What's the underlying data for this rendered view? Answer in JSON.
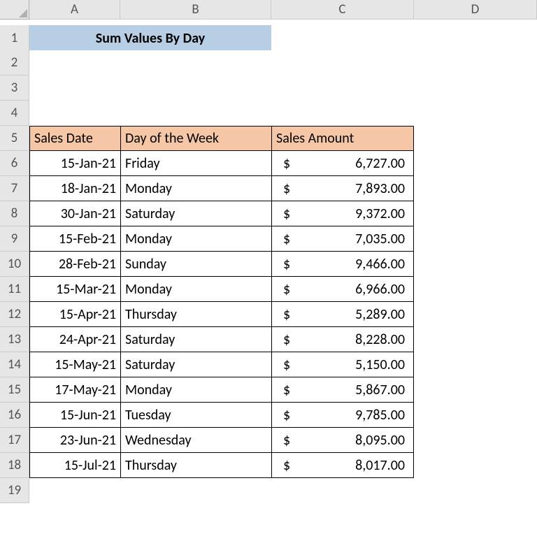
{
  "columns": [
    "A",
    "B",
    "C",
    "D"
  ],
  "row_labels": [
    "1",
    "2",
    "3",
    "4",
    "5",
    "6",
    "7",
    "8",
    "9",
    "10",
    "11",
    "12",
    "13",
    "14",
    "15",
    "16",
    "17",
    "18",
    "19"
  ],
  "title": "Sum Values By Day",
  "headers": {
    "a": "Sales Date",
    "b": "Day of the Week",
    "c": "Sales Amount"
  },
  "currency_symbol": "$",
  "rows": [
    {
      "date": "15-Jan-21",
      "dow": "Friday",
      "amount": "6,727.00"
    },
    {
      "date": "18-Jan-21",
      "dow": "Monday",
      "amount": "7,893.00"
    },
    {
      "date": "30-Jan-21",
      "dow": "Saturday",
      "amount": "9,372.00"
    },
    {
      "date": "15-Feb-21",
      "dow": "Monday",
      "amount": "7,035.00"
    },
    {
      "date": "28-Feb-21",
      "dow": "Sunday",
      "amount": "9,466.00"
    },
    {
      "date": "15-Mar-21",
      "dow": "Monday",
      "amount": "6,966.00"
    },
    {
      "date": "15-Apr-21",
      "dow": "Thursday",
      "amount": "5,289.00"
    },
    {
      "date": "24-Apr-21",
      "dow": "Saturday",
      "amount": "8,228.00"
    },
    {
      "date": "15-May-21",
      "dow": "Saturday",
      "amount": "5,150.00"
    },
    {
      "date": "17-May-21",
      "dow": "Monday",
      "amount": "5,867.00"
    },
    {
      "date": "15-Jun-21",
      "dow": "Tuesday",
      "amount": "9,785.00"
    },
    {
      "date": "23-Jun-21",
      "dow": "Wednesday",
      "amount": "8,095.00"
    },
    {
      "date": "15-Jul-21",
      "dow": "Thursday",
      "amount": "8,017.00"
    }
  ],
  "chart_data": {
    "type": "table",
    "title": "Sum Values By Day",
    "columns": [
      "Sales Date",
      "Day of the Week",
      "Sales Amount ($)"
    ],
    "rows": [
      [
        "15-Jan-21",
        "Friday",
        6727.0
      ],
      [
        "18-Jan-21",
        "Monday",
        7893.0
      ],
      [
        "30-Jan-21",
        "Saturday",
        9372.0
      ],
      [
        "15-Feb-21",
        "Monday",
        7035.0
      ],
      [
        "28-Feb-21",
        "Sunday",
        9466.0
      ],
      [
        "15-Mar-21",
        "Monday",
        6966.0
      ],
      [
        "15-Apr-21",
        "Thursday",
        5289.0
      ],
      [
        "24-Apr-21",
        "Saturday",
        8228.0
      ],
      [
        "15-May-21",
        "Saturday",
        5150.0
      ],
      [
        "17-May-21",
        "Monday",
        5867.0
      ],
      [
        "15-Jun-21",
        "Tuesday",
        9785.0
      ],
      [
        "23-Jun-21",
        "Wednesday",
        8095.0
      ],
      [
        "15-Jul-21",
        "Thursday",
        8017.0
      ]
    ]
  }
}
